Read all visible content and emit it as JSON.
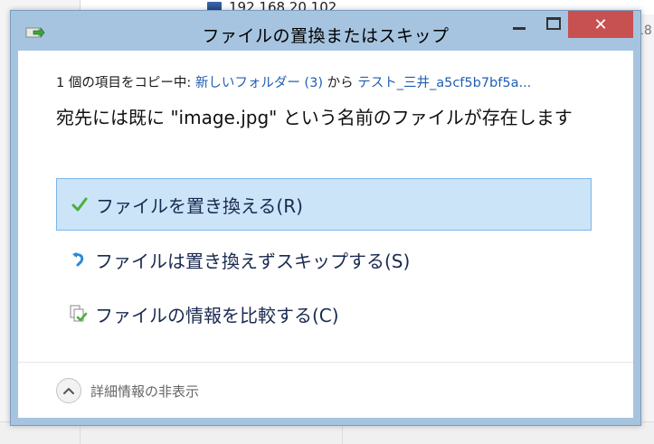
{
  "background": {
    "network_item": "192.168.20.102",
    "right_fragment": "18"
  },
  "dialog": {
    "title": "ファイルの置換またはスキップ",
    "close_symbol": "✕",
    "copy_prefix": "1 個の項目をコピー中: ",
    "source_folder": "新しいフォルダー (3)",
    "from_word": " から ",
    "dest_folder": "テスト_三井_a5cf5b7bf5a...",
    "headline": "宛先には既に \"image.jpg\" という名前のファイルが存在します",
    "options": [
      {
        "label": "ファイルを置き換える(R)",
        "icon": "check-icon"
      },
      {
        "label": "ファイルは置き換えずスキップする(S)",
        "icon": "skip-arrow-icon"
      },
      {
        "label": "ファイルの情報を比較する(C)",
        "icon": "compare-files-icon"
      }
    ],
    "details_label": "詳細情報の非表示"
  },
  "colors": {
    "titlebar": "#a6c4e0",
    "close_button": "#c75050",
    "link": "#1f5fb3",
    "selected_option_bg": "#cce4f7",
    "selected_option_border": "#7eb4ea"
  }
}
